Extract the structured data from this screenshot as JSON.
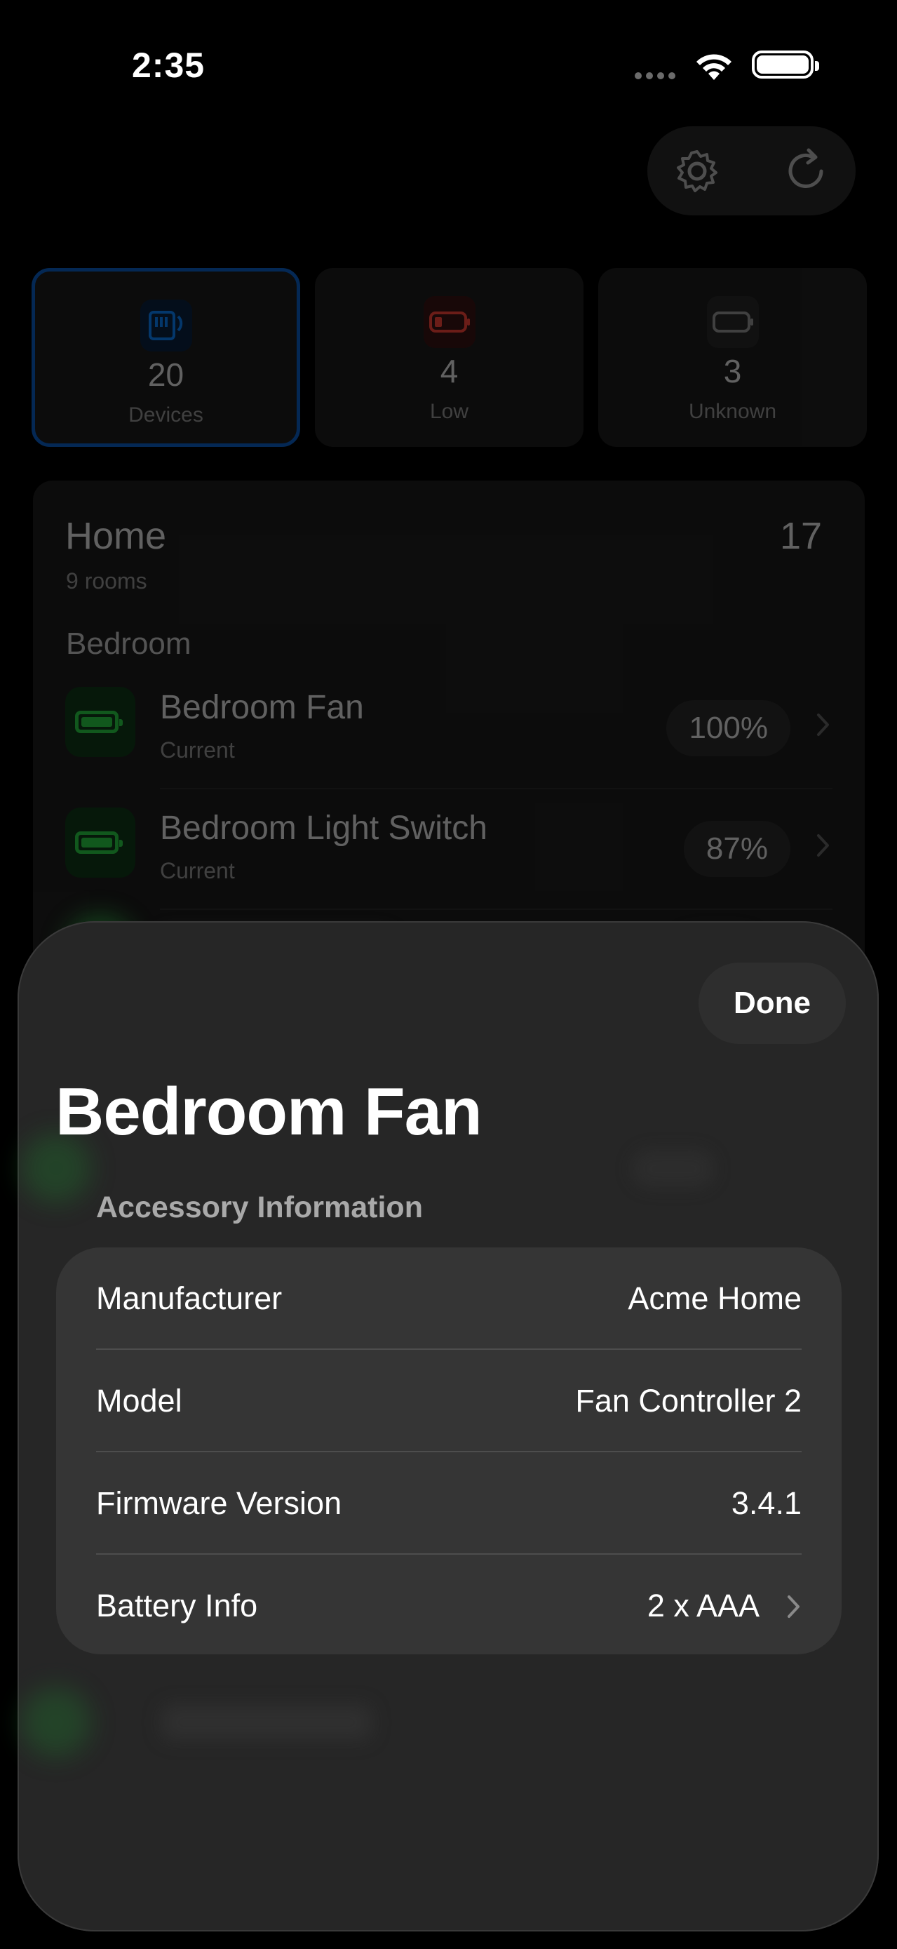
{
  "status_bar": {
    "time": "2:35"
  },
  "summary": [
    {
      "value": "20",
      "label": "Devices",
      "icon": "device-icon",
      "color": "#0a84ff"
    },
    {
      "value": "4",
      "label": "Low",
      "icon": "low-battery-icon",
      "color": "#ff453a"
    },
    {
      "value": "3",
      "label": "Unknown",
      "icon": "empty-battery-icon",
      "color": "#8e8e93"
    }
  ],
  "toolbar": {
    "settings_icon": "gear-icon",
    "refresh_icon": "refresh-icon"
  },
  "home": {
    "title": "Home",
    "rooms": "9 rooms",
    "count": "17",
    "room_header": "Bedroom",
    "devices": [
      {
        "name": "Bedroom Fan",
        "status": "Current",
        "percent": "100%",
        "level": 1.0
      },
      {
        "name": "Bedroom Light Switch",
        "status": "Current",
        "percent": "87%",
        "level": 0.87
      }
    ]
  },
  "sheet": {
    "done_label": "Done",
    "title": "Bedroom Fan",
    "section_header": "Accessory Information",
    "rows": [
      {
        "key": "Manufacturer",
        "value": "Acme Home"
      },
      {
        "key": "Model",
        "value": "Fan Controller 2"
      },
      {
        "key": "Firmware Version",
        "value": "3.4.1"
      },
      {
        "key": "Battery Info",
        "value": "2 x AAA"
      }
    ]
  }
}
